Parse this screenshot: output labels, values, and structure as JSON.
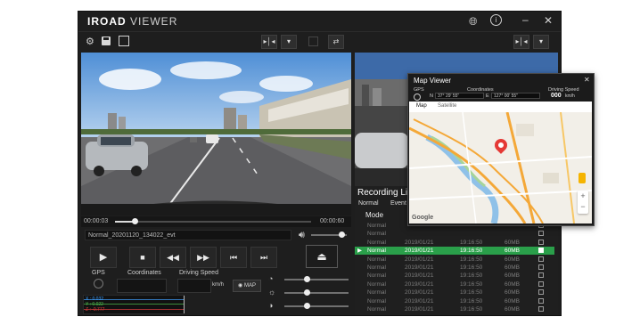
{
  "app": {
    "brand_bold": "IROAD",
    "brand_light": "VIEWER"
  },
  "player": {
    "time_start": "00:00:03",
    "time_end": "00:00:60",
    "progress": 0.1,
    "volume": 0.85,
    "file_name": "Normal_20201120_134022_evt",
    "speed_unit": "km/h",
    "map_button_label": "MAP"
  },
  "sensors": {
    "gps_label": "GPS",
    "coordinates_label": "Coordinates",
    "speed_label": "Driving Speed",
    "axis_x": "X : 0.032",
    "axis_y": "Y : 0.022",
    "axis_z": "Z : -0.777",
    "slider_values": [
      0.35,
      0.35,
      0.35
    ]
  },
  "recording_list": {
    "title": "Recording List",
    "tabs": [
      "Normal",
      "Event"
    ],
    "mode_label": "Mode",
    "rows": [
      {
        "mode": "Normal",
        "date": "",
        "time": "",
        "size": "",
        "selected": false,
        "checked": false
      },
      {
        "mode": "Normal",
        "date": "",
        "time": "",
        "size": "",
        "selected": false,
        "checked": false
      },
      {
        "mode": "Normal",
        "date": "2019/01/21",
        "time": "19:16:50",
        "size": "60MB",
        "selected": false,
        "checked": false
      },
      {
        "mode": "Normal",
        "date": "2019/01/21",
        "time": "19:16:50",
        "size": "60MB",
        "selected": true,
        "checked": true
      },
      {
        "mode": "Normal",
        "date": "2019/01/21",
        "time": "19:16:50",
        "size": "60MB",
        "selected": false,
        "checked": false
      },
      {
        "mode": "Normal",
        "date": "2019/01/21",
        "time": "19:16:50",
        "size": "60MB",
        "selected": false,
        "checked": false
      },
      {
        "mode": "Normal",
        "date": "2019/01/21",
        "time": "19:16:50",
        "size": "60MB",
        "selected": false,
        "checked": false
      },
      {
        "mode": "Normal",
        "date": "2019/01/21",
        "time": "19:16:50",
        "size": "60MB",
        "selected": false,
        "checked": false
      },
      {
        "mode": "Normal",
        "date": "2019/01/21",
        "time": "19:16:50",
        "size": "60MB",
        "selected": false,
        "checked": false
      },
      {
        "mode": "Normal",
        "date": "2019/01/21",
        "time": "19:16:50",
        "size": "60MB",
        "selected": false,
        "checked": false
      },
      {
        "mode": "Normal",
        "date": "2019/01/21",
        "time": "19:16:50",
        "size": "60MB",
        "selected": false,
        "checked": false
      }
    ]
  },
  "map_viewer": {
    "title": "Map Viewer",
    "gps_label": "GPS",
    "coordinates_label": "Coordinates",
    "speed_label": "Driving Speed",
    "lat_prefix": "N",
    "lat_value": "37° 29' 55\"",
    "lon_prefix": "E",
    "lon_value": "127° 00' 55\"",
    "speed_value": "000",
    "speed_unit": "km/h",
    "tab_map": "Map",
    "tab_satellite": "Satellite",
    "attribution": "Google"
  },
  "colors": {
    "accent_green": "#2a9f4a",
    "marker_red": "#e53935"
  }
}
